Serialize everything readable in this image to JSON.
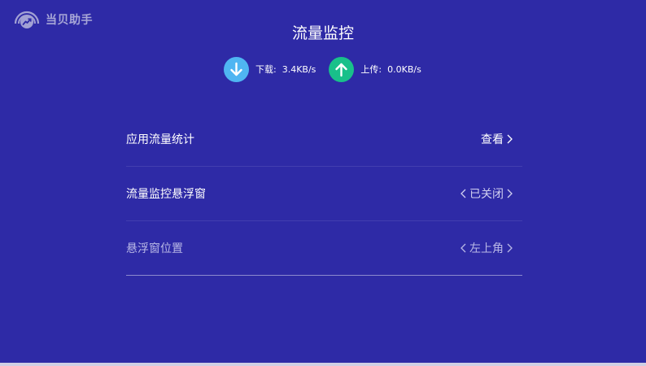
{
  "app": {
    "logo_text": "当贝助手"
  },
  "title": "流量监控",
  "speed": {
    "download_label": "下载:",
    "download_value": "3.4KB/s",
    "upload_label": "上传:",
    "upload_value": "0.0KB/s",
    "download_color": "#4fb5f2",
    "upload_color": "#19c08a"
  },
  "settings": [
    {
      "label": "应用流量统计",
      "value": "查看"
    },
    {
      "label": "流量监控悬浮窗",
      "value": "已关闭"
    },
    {
      "label": "悬浮窗位置",
      "value": "左上角"
    }
  ],
  "colors": {
    "background": "#2e2aa6",
    "text": "#ffffff",
    "dim_text": "#b9b8e6"
  }
}
